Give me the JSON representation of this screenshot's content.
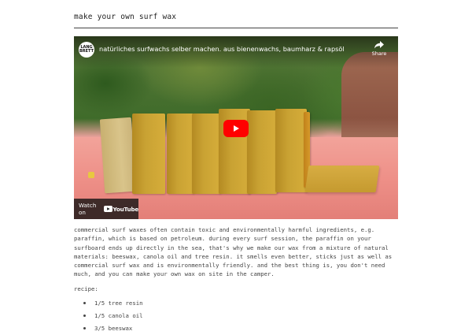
{
  "top_link": "———",
  "page_title": "make your own surf wax",
  "video": {
    "channel_avatar_text": "LANG BRETT",
    "title": "natürliches surfwachs selber machen. aus bienenwachs, baumharz & rapsöl",
    "share_label": "Share",
    "watch_on_label": "Watch on",
    "youtube_label": "YouTube",
    "play_color": "#ff0000"
  },
  "body_text": "commercial surf waxes often contain toxic and environmentally harmful ingredients, e.g. paraffin, which is based on petroleum. during every surf session, the paraffin on your surfboard ends up directly in the sea, that's why we make our wax from a mixture of natural materials: beeswax, canola oil and tree resin. it smells even better, sticks just as well as commercial surf wax and is environmentally friendly. and the best thing is, you don't need much, and you can make your own wax on site in the camper.",
  "recipe_label": "recipe:",
  "recipe_items": [
    "1/5 tree resin",
    "1/5 canola oil",
    "3/5 beeswax"
  ],
  "colors": {
    "link": "#4a7bbf",
    "text": "#444444",
    "play": "#ff0000"
  }
}
